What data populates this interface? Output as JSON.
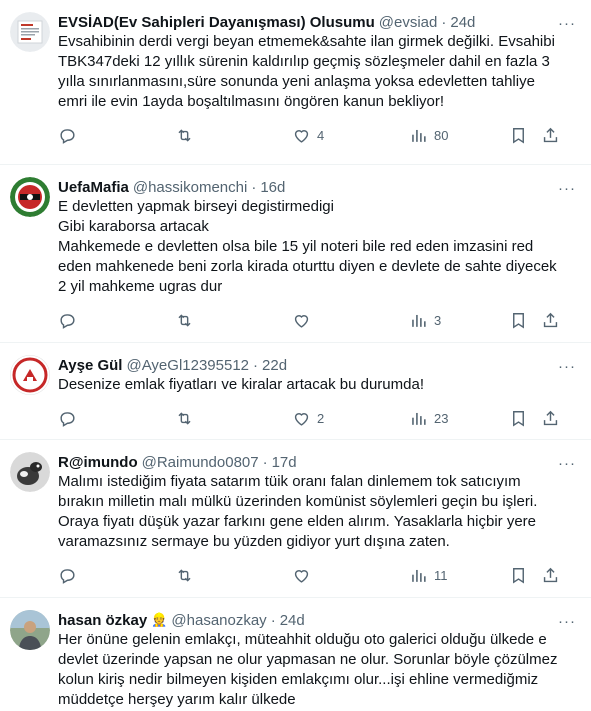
{
  "tweets": [
    {
      "name": "EVSİAD(Ev Sahipleri Dayanışması) Olusumu",
      "handle": "@evsiad",
      "time": "24d",
      "lines": [
        "Evsahibinin derdi vergi beyan etmemek&sahte ilan girmek değilki. Evsahibi",
        "TBK347deki 12 yıllık sürenin kaldırılıp geçmiş sözleşmeler dahil en fazla 3",
        "yılla sınırlanmasını,süre sonunda yeni anlaşma yoksa edevletten tahliye",
        "emri ile evin 1ayda boşaltılmasını öngören kanun bekliyor!"
      ],
      "replies": "",
      "retweets": "",
      "likes": "4",
      "views": "80"
    },
    {
      "name": "UefaMafia",
      "handle": "@hassikomenchi",
      "time": "16d",
      "lines": [
        "E devletten yapmak birseyi degistirmedigi",
        "Gibi karaborsa artacak",
        "Mahkemede e devletten olsa bile 15 yil noteri bile red eden imzasini red",
        "eden mahkenede beni zorla kirada oturttu diyen e devlete de sahte diyecek",
        "2 yil mahkeme ugras dur"
      ],
      "replies": "",
      "retweets": "",
      "likes": "",
      "views": "3"
    },
    {
      "name": "Ayşe Gül",
      "handle": "@AyeGl12395512",
      "time": "22d",
      "lines": [
        "Desenize emlak fiyatları ve kiralar artacak bu durumda!"
      ],
      "replies": "",
      "retweets": "",
      "likes": "2",
      "views": "23"
    },
    {
      "name": "R@imundo",
      "handle": "@Raimundo0807",
      "time": "17d",
      "lines": [
        "Malımı istediğim fiyata satarım tüik oranı falan dinlemem tok satıcıyım",
        "bırakın milletin malı mülkü üzerinden komünist söylemleri geçin bu işleri.",
        "Oraya fiyatı düşük yazar farkını gene elden alırım. Yasaklarla hiçbir yere",
        "varamazsınız sermaye bu yüzden gidiyor yurt dışına zaten."
      ],
      "replies": "",
      "retweets": "",
      "likes": "",
      "views": "11"
    },
    {
      "name": "hasan özkay",
      "handle": "@hasanozkay",
      "time": "24d",
      "lines": [
        "Her önüne gelenin emlakçı, müteahhit olduğu oto galerici olduğu ülkede e",
        "devlet üzerinde yapsan ne olur yapmasan ne olur. Sorunlar böyle çözülmez",
        "kolun kiriş nedir bilmeyen kişiden emlakçımı olur...işi ehline vermediğmiz",
        "müddetçe herşey yarım kalır ülkede"
      ],
      "replies": "",
      "retweets": "",
      "likes": "",
      "views": ""
    }
  ],
  "ui": {
    "dot": "·",
    "more": "···",
    "crown_emoji": "👷"
  },
  "colors": {
    "text": "#0f1419",
    "secondary": "#536471",
    "divider": "#eff3f4"
  },
  "icons": [
    "reply-icon",
    "retweet-icon",
    "like-icon",
    "views-icon",
    "bookmark-icon",
    "share-icon",
    "more-icon"
  ]
}
